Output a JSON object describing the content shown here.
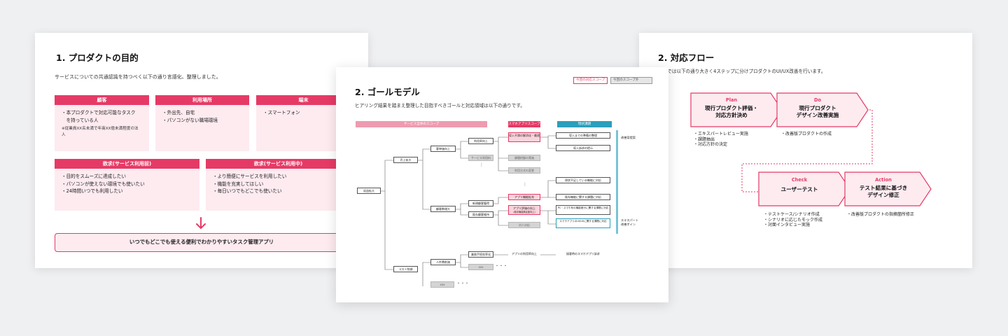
{
  "slide1": {
    "title": "1. プロダクトの目的",
    "subtitle": "サービスについての共通認識を持つべく以下の通り言語化、整理しました。",
    "cards": [
      {
        "header": "顧客",
        "items": [
          "・本プロダクトで対応可能なタスク",
          "　を持っている人"
        ],
        "note": "※従業員XX名未満で年商XX億未満程度の法人"
      },
      {
        "header": "利用場所",
        "items": [
          "・外出先、自宅",
          "・パソコンがない職場環境"
        ]
      },
      {
        "header": "端末",
        "items": [
          "・スマートフォン"
        ]
      },
      {
        "header": "欲求(サービス利用前)",
        "items": [
          "・目的をスムーズに達成したい",
          "・パソコンが使えない環境でも使いたい",
          "・24時間いつでも利用したい"
        ]
      },
      {
        "header": "欲求(サービス利用中)",
        "items": [
          "・より簡便にサービスを利用したい",
          "・機能を充実してほしい",
          "・毎日いつでもどこでも使いたい"
        ]
      }
    ],
    "goal": "いつでもどこでも使える便利でわかりやすいタスク管理アプリ",
    "colors": {
      "accent": "#e63a66",
      "card_bg": "#fdebf0"
    }
  },
  "slide2": {
    "title": "2. ゴールモデル",
    "subtitle": "ヒアリング結果を踏まえ整理した目指すべきゴールと対応領域は以下の通りです。",
    "tags": [
      "今回の対応スコープ",
      "今回のスコープ外"
    ],
    "bands": [
      "サービス全体のスコープ",
      "スマホアプリスコープ",
      "現状課題"
    ],
    "nodes": {
      "root": "収益拡大",
      "l1": [
        "売上拡大",
        "コスト削減"
      ],
      "l2": [
        "客単価向上",
        "顧客数増大",
        "人件費削減"
      ],
      "l3": [
        "利用率向上",
        "サービス利用料",
        "新規顧客獲得",
        "既存顧客維持",
        "業務手続効率化",
        "xxx"
      ],
      "l4": [
        "導入不満の解消化・最適化",
        "課題把握の実施",
        "利用方式の変更",
        "アプリ機能拡充",
        "アプリ評価の向上",
        "(既存機能満足度向上)",
        "対人対応",
        "アプリの利用率向上",
        "xxx"
      ],
      "l5": [
        "導入までの準備の整理",
        "導入訴求の提示",
        "現状不足している機能に対応",
        "既存機能に関する課題に対応",
        "PC・スマホ系の機能差分に関する課題に対応",
        "スマホアプリのUI/UXに関する課題に対応",
        "接客時のスマホアプリ訴求"
      ]
    },
    "right_labels": [
      "改善案提案",
      "エキスパート",
      "改善ポイン"
    ],
    "dots": "・・・"
  },
  "slide3": {
    "title": "2. 対応フロー",
    "subtitle": "本件では以下の通り大きく4ステップに分けプロダクトのUI/UX改善を行います。",
    "steps": [
      {
        "en": "Plan",
        "jp1": "現行プロダクト評価・",
        "jp2": "対応方針決め",
        "items": [
          "・エキスパートレビュー実施",
          "・課題抽出",
          "・対応方針の決定"
        ]
      },
      {
        "en": "Do",
        "jp1": "現行プロダクト",
        "jp2": "デザイン改善実施",
        "items": [
          "・改善版プロダクトの作成"
        ]
      },
      {
        "en": "Check",
        "jp1": "ユーザーテスト",
        "jp2": "",
        "items": [
          "・テストケース/シナリオ作成",
          "・シナリオに応じたモック作成",
          "・対面インタビュー実施"
        ]
      },
      {
        "en": "Action",
        "jp1": "テスト結果に基づき",
        "jp2": "デザイン修正",
        "items": [
          "・改善版プロダクトの指摘箇所修正"
        ]
      }
    ]
  }
}
